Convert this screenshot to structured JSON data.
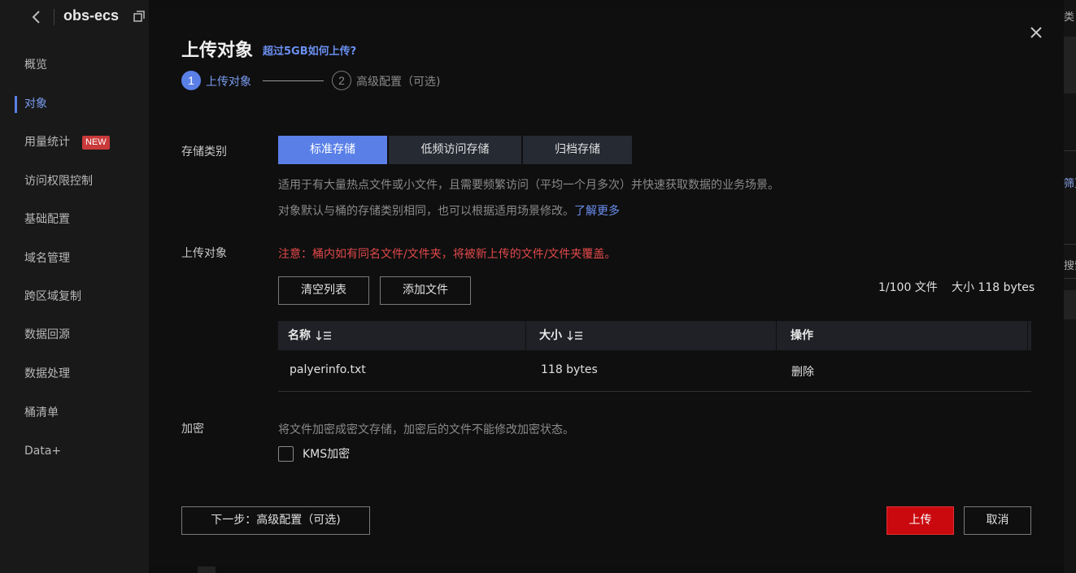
{
  "sidebar": {
    "bucket_name": "obs-ecs",
    "items": [
      {
        "label": "概览"
      },
      {
        "label": "对象"
      },
      {
        "label": "用量统计"
      },
      {
        "label": "访问权限控制"
      },
      {
        "label": "基础配置"
      },
      {
        "label": "域名管理"
      },
      {
        "label": "跨区域复制"
      },
      {
        "label": "数据回源"
      },
      {
        "label": "数据处理"
      },
      {
        "label": "桶清单"
      },
      {
        "label": "Data+"
      }
    ],
    "active_item": "对象",
    "new_badge": "NEW"
  },
  "background_right": {
    "texts": [
      "类",
      "筛更",
      "搜索"
    ]
  },
  "dialog": {
    "title": "上传对象",
    "help_link": "超过5GB如何上传?",
    "steps": [
      {
        "number": "1",
        "label": "上传对象",
        "active": true
      },
      {
        "number": "2",
        "label": "高级配置（可选)",
        "active": false
      }
    ],
    "storage": {
      "label": "存储类别",
      "options": [
        "标准存储",
        "低频访问存储",
        "归档存储"
      ],
      "selected": "标准存储",
      "description": "适用于有大量热点文件或小文件，且需要频繁访问（平均一个月多次）并快速获取数据的业务场景。",
      "note": "对象默认与桶的存储类别相同，也可以根据适用场景修改。",
      "learn_more": "了解更多"
    },
    "upload": {
      "label": "上传对象",
      "warning": "注意：桶内如有同名文件/文件夹，将被新上传的文件/文件夹覆盖。",
      "clear_button": "清空列表",
      "add_button": "添加文件",
      "file_count": "1/100 文件",
      "total_size": "大小 118 bytes",
      "columns": [
        "名称",
        "大小",
        "操作"
      ],
      "rows": [
        {
          "name": "palyerinfo.txt",
          "size": "118 bytes",
          "action": "删除"
        }
      ]
    },
    "encryption": {
      "label": "加密",
      "description": "将文件加密成密文存储，加密后的文件不能修改加密状态。",
      "kms_label": "KMS加密",
      "kms_checked": false
    },
    "footer": {
      "next_button": "下一步：高级配置（可选)",
      "upload_button": "上传",
      "cancel_button": "取消"
    }
  },
  "colors": {
    "accent": "#5a80e8",
    "link": "#6a8ff0",
    "danger": "#c9090e",
    "warning_text": "#e0484a",
    "badge": "#c9393a"
  }
}
